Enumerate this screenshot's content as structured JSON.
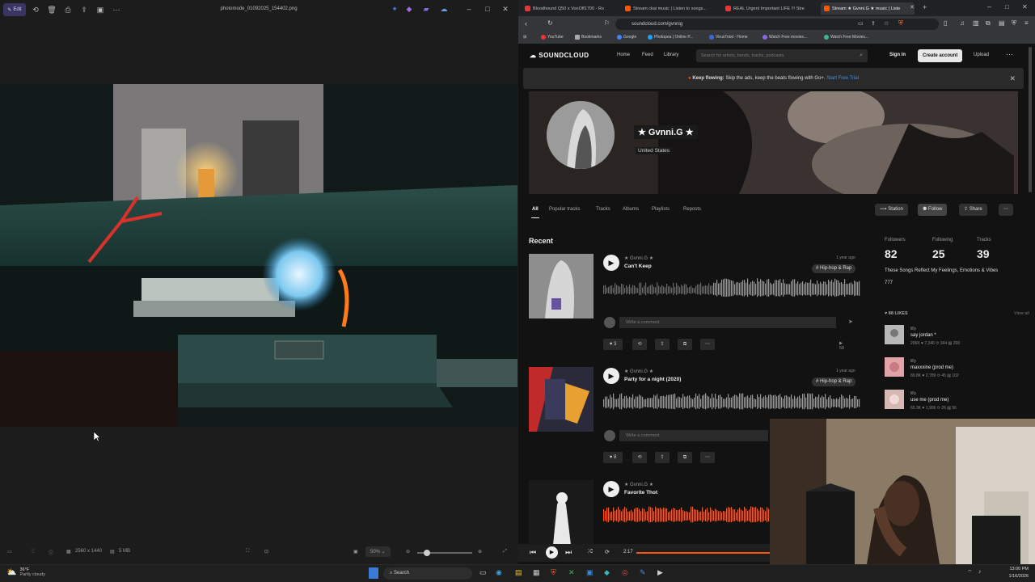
{
  "viewer": {
    "edit_label": "Edit",
    "filename": "photomode_01092025_154402.png",
    "dimensions": "2560 x 1440",
    "filesize": "5 MB",
    "zoom": "50%"
  },
  "browser": {
    "tabs": [
      {
        "label": "Bloodhound Q50 x VonOff1700 - Ro"
      },
      {
        "label": "Stream ckai music | Listen to songs..."
      },
      {
        "label": "REAL Urgent Important LIFE !!! Stre"
      },
      {
        "label": "Stream ★ Gvnni.G ★ music | Liste"
      }
    ],
    "url": "soundcloud.com/gvnnig",
    "bookmarks": [
      "YouTube",
      "Bookmarks",
      "Google",
      "Photopea | Online P...",
      "VirusTotal - Home",
      "Watch Free movies...",
      "Watch Free Movies..."
    ]
  },
  "soundcloud": {
    "logo": "SOUNDCLOUD",
    "nav": [
      "Home",
      "Feed",
      "Library"
    ],
    "search_placeholder": "Search for artists, bands, tracks, podcasts",
    "sign_in": "Sign in",
    "create_account": "Create account",
    "upload": "Upload",
    "banner_bold": "Keep flowing:",
    "banner_text": "Skip the ads, keep the beats flowing with Go+.",
    "banner_link": "Start Free Trial",
    "profile_name": "★ Gvnni.G ★",
    "profile_location": "United States",
    "tabs": [
      "All",
      "Popular tracks",
      "Tracks",
      "Albums",
      "Playlists",
      "Reposts"
    ],
    "buttons": {
      "station": "Station",
      "follow": "Follow",
      "share": "Share"
    },
    "recent_label": "Recent",
    "tracks": [
      {
        "artist": "★ Gvnni.G ★",
        "title": "Can't Keep",
        "age": "1 year ago",
        "tag": "# Hip-hop & Rap",
        "likes": "3",
        "plays": "58",
        "comment_placeholder": "Write a comment"
      },
      {
        "artist": "★ Gvnni.G ★",
        "title": "Party for a night (2020)",
        "age": "1 year ago",
        "tag": "# Hip-hop & Rap",
        "likes": "8",
        "plays": "",
        "comment_placeholder": "Write a comment"
      },
      {
        "artist": "★ Gvnni.G ★",
        "title": "Favorite Thot",
        "age": "",
        "tag": "",
        "likes": "",
        "plays": "",
        "comment_placeholder": ""
      }
    ],
    "stats": {
      "followers_label": "Followers",
      "followers": "82",
      "following_label": "Following",
      "following": "25",
      "tracks_label": "Tracks",
      "tracks": "39"
    },
    "bio": "These Songs Reflect My Feelings, Emotions & Vibes",
    "bio2": "777",
    "likes_header": "88 LIKES",
    "view_all": "View all",
    "likes": [
      {
        "user": "lilly",
        "title": "say jordan *",
        "stats": "206K ♥ 7,346 ⟳ 344 ▤ 260"
      },
      {
        "user": "lilly",
        "title": "maxxxine (prod me)",
        "stats": "89.8K ♥ 2,789 ⟳ 45 ▤ 102"
      },
      {
        "user": "lilly",
        "title": "use me (prod me)",
        "stats": "65.3K ♥ 1,906 ⟳ 26 ▤ 56"
      }
    ],
    "player_time": "2:17"
  },
  "taskbar": {
    "weather_temp": "36°F",
    "weather_desc": "Partly cloudy",
    "search_label": "Search",
    "time": "13:00 PM",
    "date": "1/16/2026"
  },
  "colors": {
    "soundcloud_orange": "#ff5500",
    "edit_purple": "#3a3560"
  }
}
